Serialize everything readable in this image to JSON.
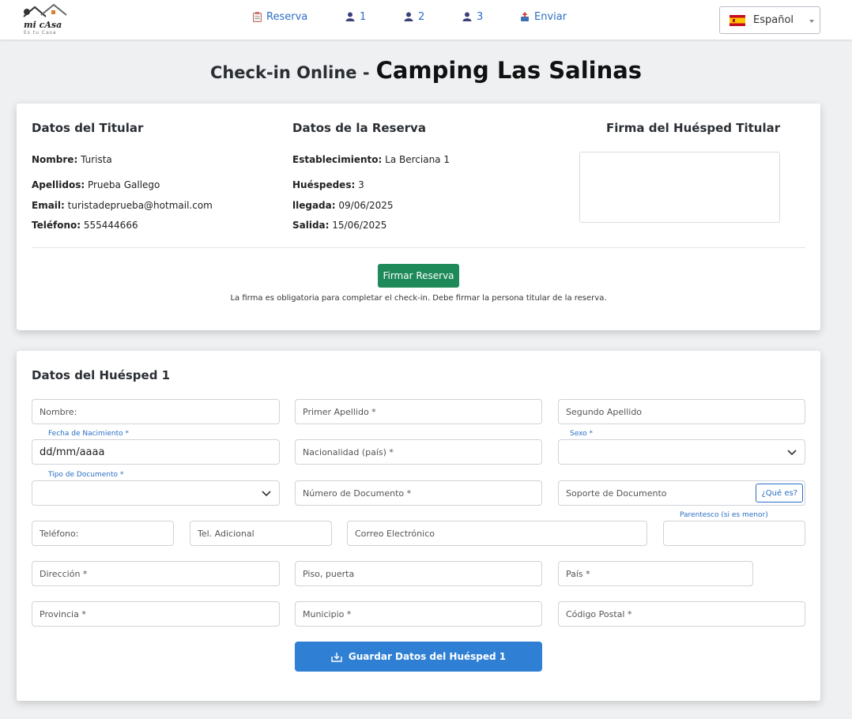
{
  "brand": {
    "logo_text": "mi cAsa",
    "logo_sub": "Es tu Casa"
  },
  "nav": {
    "items": [
      {
        "label": "Reserva",
        "icon": "clipboard-icon"
      },
      {
        "label": "1",
        "icon": "user-icon"
      },
      {
        "label": "2",
        "icon": "user-icon"
      },
      {
        "label": "3",
        "icon": "user-icon"
      },
      {
        "label": "Enviar",
        "icon": "send-icon"
      }
    ],
    "language": "Español"
  },
  "title": {
    "prefix": "Check-in Online -",
    "name": "Camping Las Salinas"
  },
  "holder": {
    "title": "Datos del Titular",
    "fields": [
      {
        "label": "Nombre:",
        "value": "Turista"
      },
      {
        "label": "Apellidos:",
        "value": "Prueba Gallego"
      },
      {
        "label": "Email:",
        "value": "turistadeprueba@hotmail.com"
      },
      {
        "label": "Teléfono:",
        "value": "555444666"
      }
    ]
  },
  "booking": {
    "title": "Datos de la Reserva",
    "fields": [
      {
        "label": "Establecimiento:",
        "value": "La Berciana 1"
      },
      {
        "label": "Huéspedes:",
        "value": "3"
      },
      {
        "label": "llegada:",
        "value": "09/06/2025"
      },
      {
        "label": "Salida:",
        "value": "15/06/2025"
      }
    ]
  },
  "signature": {
    "title": "Firma del Huésped Titular",
    "button": "Firmar Reserva",
    "note": "La firma es obligatoria para completar el check-in. Debe firmar la persona titular de la reserva."
  },
  "guest": {
    "title": "Datos del Huésped 1",
    "nombre": "Nombre:",
    "primer_apellido": "Primer Apellido *",
    "segundo_apellido": "Segundo Apellido",
    "fecha_label": "Fecha de Nacimiento *",
    "fecha_value": "dd/mm/aaaa",
    "nacionalidad": "Nacionalidad (país) *",
    "sexo_label": "Sexo *",
    "tipo_doc_label": "Tipo de Documento *",
    "numero_doc": "Número de Documento *",
    "soporte_doc": "Soporte de Documento",
    "que_es": "¿Qué es?",
    "telefono": "Teléfono:",
    "tel_adicional": "Tel. Adicional",
    "correo": "Correo Electrónico",
    "parentesco_label": "Parentesco (si es menor)",
    "direccion": "Dirección *",
    "piso": "Piso, puerta",
    "pais": "País *",
    "provincia": "Provincia *",
    "municipio": "Municipio *",
    "codigo_postal": "Código Postal *",
    "save_button": "Guardar Datos del Huésped 1"
  },
  "colors": {
    "accent_blue": "#2f80d4",
    "link_blue": "#2a6fc4",
    "green": "#1e8a5a"
  }
}
